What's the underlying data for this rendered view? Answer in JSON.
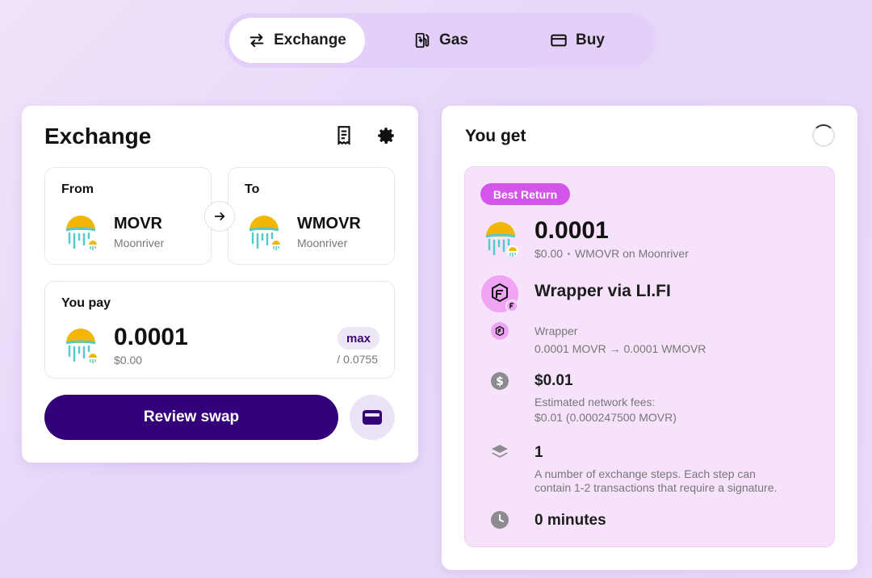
{
  "tabs": [
    {
      "label": "Exchange",
      "icon": "swap-arrows-icon"
    },
    {
      "label": "Gas",
      "icon": "gas-pump-icon"
    },
    {
      "label": "Buy",
      "icon": "credit-card-icon"
    }
  ],
  "exchange": {
    "title": "Exchange",
    "from": {
      "label": "From",
      "symbol": "MOVR",
      "chain": "Moonriver"
    },
    "to": {
      "label": "To",
      "symbol": "WMOVR",
      "chain": "Moonriver"
    },
    "pay": {
      "label": "You pay",
      "amount": "0.0001",
      "usd": "$0.00",
      "max_label": "max",
      "balance": "/ 0.0755"
    },
    "review_label": "Review swap"
  },
  "you_get": {
    "title": "You get",
    "badge": "Best Return",
    "amount": "0.0001",
    "usd": "$0.00",
    "token_chain": "WMOVR on Moonriver",
    "route_title": "Wrapper via LI.FI",
    "step": {
      "name": "Wrapper",
      "detail": "0.0001 MOVR → 0.0001 WMOVR"
    },
    "fee": {
      "value": "$0.01",
      "line1": "Estimated network fees:",
      "line2": "$0.01 (0.000247500 MOVR)"
    },
    "steps": {
      "value": "1",
      "line1": "A number of exchange steps. Each step can",
      "line2": "contain 1-2 transactions that require a signature."
    },
    "time": {
      "value": "0 minutes"
    }
  },
  "colors": {
    "primary": "#33007a",
    "badge": "#d455ea",
    "route_bg": "#f6e2fb",
    "tab_track": "#e3cff7"
  }
}
